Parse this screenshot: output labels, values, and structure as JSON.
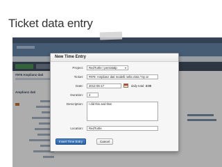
{
  "slide": {
    "title": "Ticket data entry"
  },
  "background_app": {
    "subject": "#978 Amplianz dati",
    "section": "Amplianz dati"
  },
  "dialog": {
    "title": "New Time Entry",
    "fields": {
      "project": {
        "label": "Project:",
        "value": "RedTurtle / persistalp"
      },
      "ticket": {
        "label": "Ticket:",
        "value": "#978: Amplianz dati modelli nella vista \"my ar"
      },
      "date": {
        "label": "Date:",
        "value": "2012-06-17",
        "daily_label": "daily total:",
        "daily_total": "3:00"
      },
      "duration": {
        "label": "Duration:",
        "value": "2"
      },
      "description": {
        "label": "Description:",
        "value": "I did this and that"
      },
      "location": {
        "label": "Location:",
        "value": "RedTurtle"
      }
    },
    "buttons": {
      "insert": "Insert Time Entry",
      "cancel": "Cancel"
    }
  },
  "icons": {
    "calendar": "calendar-icon",
    "dropdown": "chevron-down-icon"
  }
}
